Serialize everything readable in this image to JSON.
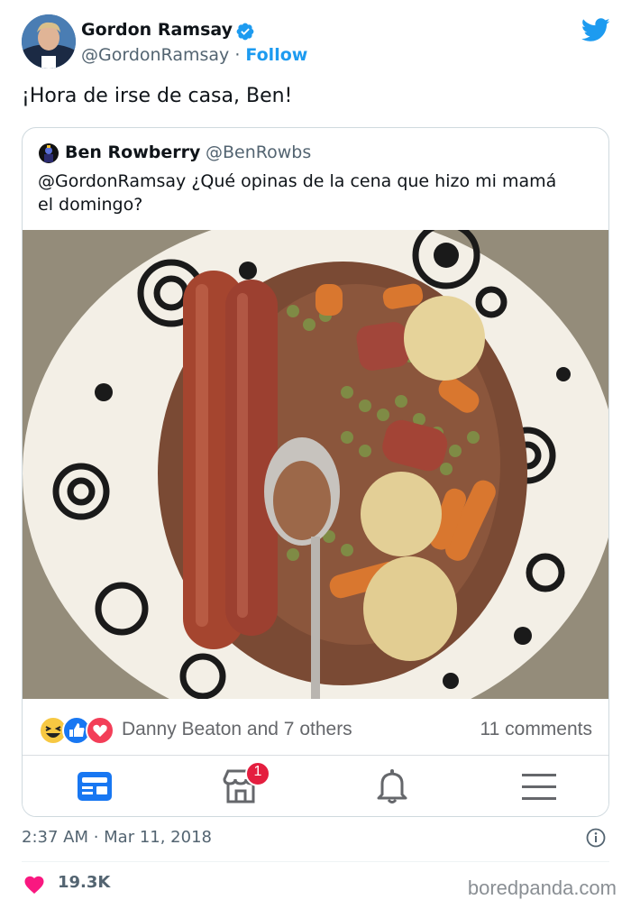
{
  "author": {
    "name": "Gordon Ramsay",
    "handle": "@GordonRamsay",
    "separator": "·",
    "follow_label": "Follow"
  },
  "tweet": {
    "text": "¡Hora de irse de casa, Ben!",
    "timestamp": "2:37 AM · Mar 11, 2018",
    "like_count": "19.3K"
  },
  "quoted": {
    "name": "Ben Rowberry",
    "handle": "@BenRowbs",
    "text": "@GordonRamsay ¿Qué opinas de la cena que hizo mi mamá el domingo?"
  },
  "facebook_bar": {
    "reactions_text": "Danny Beaton and 7 others",
    "comments_text": "11 comments",
    "notification_badge": "1",
    "reaction_icons": [
      "laugh-icon",
      "like-icon",
      "love-icon"
    ],
    "nav_icons": [
      "news-feed-icon",
      "marketplace-icon",
      "notifications-bell-icon",
      "menu-icon"
    ]
  },
  "watermark": "boredpanda.com",
  "colors": {
    "twitter_blue": "#1d9bf0",
    "heart": "#f91880",
    "fb_blue": "#1877f2",
    "badge_red": "#e41e3f",
    "secondary_text": "#536471"
  }
}
